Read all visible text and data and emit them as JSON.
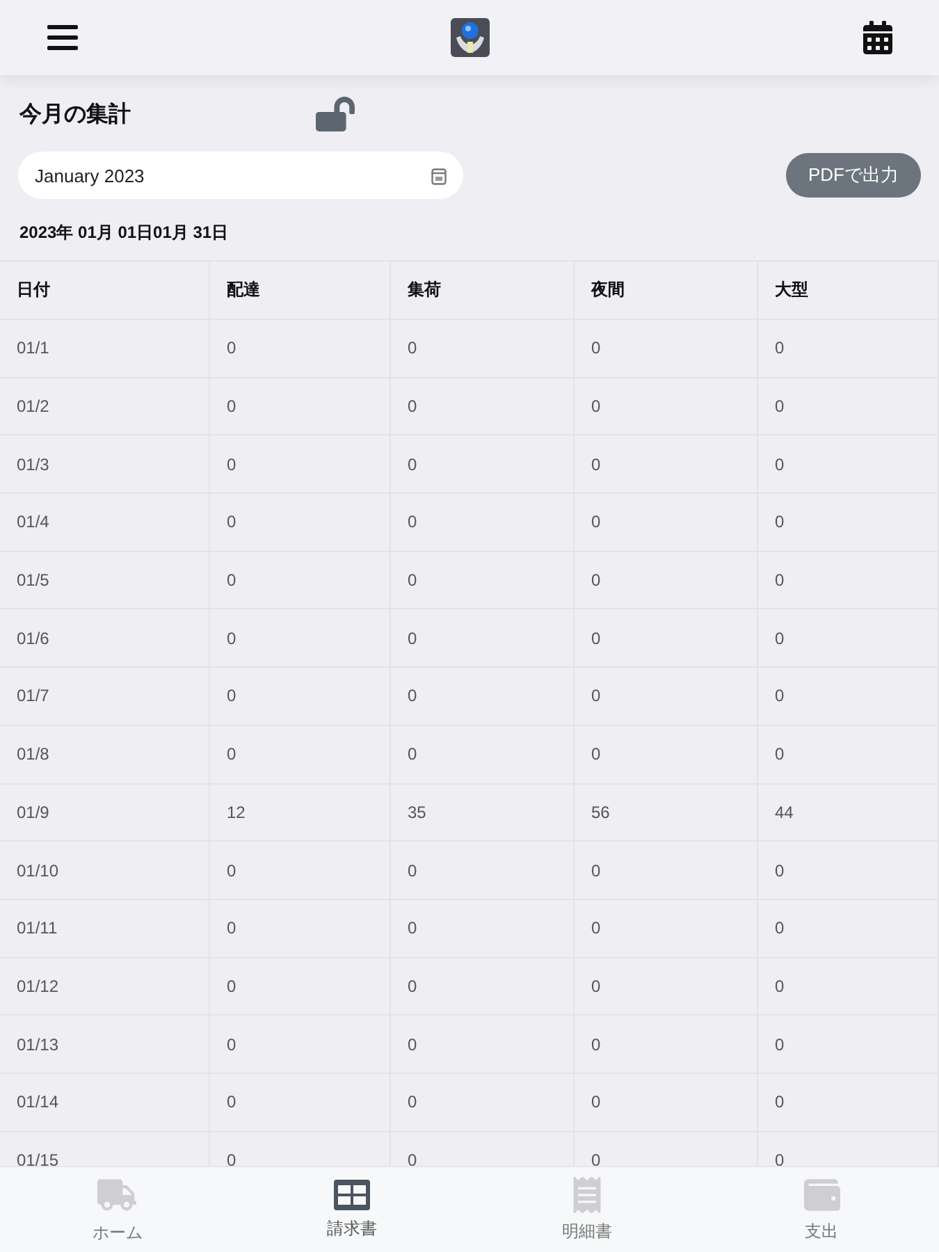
{
  "summary": {
    "title": "今月の集計",
    "locked": false,
    "month_field": {
      "value": "January 2023"
    },
    "pdf_button": "PDFで出力",
    "date_range": "2023年 01月 01日01月 31日"
  },
  "table": {
    "columns": [
      "日付",
      "配達",
      "集荷",
      "夜間",
      "大型"
    ],
    "rows": [
      [
        "01/1",
        "0",
        "0",
        "0",
        "0"
      ],
      [
        "01/2",
        "0",
        "0",
        "0",
        "0"
      ],
      [
        "01/3",
        "0",
        "0",
        "0",
        "0"
      ],
      [
        "01/4",
        "0",
        "0",
        "0",
        "0"
      ],
      [
        "01/5",
        "0",
        "0",
        "0",
        "0"
      ],
      [
        "01/6",
        "0",
        "0",
        "0",
        "0"
      ],
      [
        "01/7",
        "0",
        "0",
        "0",
        "0"
      ],
      [
        "01/8",
        "0",
        "0",
        "0",
        "0"
      ],
      [
        "01/9",
        "12",
        "35",
        "56",
        "44"
      ],
      [
        "01/10",
        "0",
        "0",
        "0",
        "0"
      ],
      [
        "01/11",
        "0",
        "0",
        "0",
        "0"
      ],
      [
        "01/12",
        "0",
        "0",
        "0",
        "0"
      ],
      [
        "01/13",
        "0",
        "0",
        "0",
        "0"
      ],
      [
        "01/14",
        "0",
        "0",
        "0",
        "0"
      ],
      [
        "01/15",
        "0",
        "0",
        "0",
        "0"
      ]
    ]
  },
  "bottom_nav": [
    {
      "kind": "truck",
      "label": "ホーム",
      "selected": false
    },
    {
      "kind": "grid",
      "label": "請求書",
      "selected": true
    },
    {
      "kind": "receipt",
      "label": "明細書",
      "selected": false
    },
    {
      "kind": "wallet",
      "label": "支出",
      "selected": false
    }
  ]
}
